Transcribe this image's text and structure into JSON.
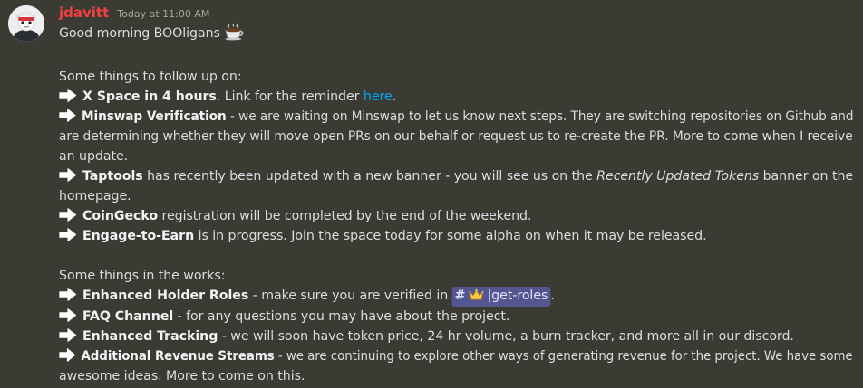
{
  "message": {
    "author": "jdavitt",
    "timestamp": "Today at 11:00 AM",
    "greeting": "Good morning BOOligans",
    "greeting_emoji": "coffee-emoji",
    "follow_up_heading": "Some things to follow up on:",
    "xspace": {
      "bold": "X Space in 4 hours",
      "text": ". Link for the reminder ",
      "link": "here",
      "end": "."
    },
    "minswap": {
      "bold": "Minswap Verification",
      "line1": " - we are waiting on Minswap to let us know next steps. They are switching repositories on Github and",
      "line2": "are determining whether they will move open PRs on our behalf or request us to re-create the PR. More to come when I receive",
      "line3": "an update."
    },
    "taptools": {
      "bold": "Taptools",
      "line1": " has recently been updated with a new banner - you will see us on the ",
      "italic": "Recently Updated Tokens",
      "line1_end": " banner on the",
      "line2": "homepage."
    },
    "coingecko": {
      "bold": "CoinGecko",
      "text": " registration will be completed by the end of the weekend."
    },
    "engage": {
      "bold": "Engage-to-Earn",
      "text": " is in progress. Join the space today for some alpha on when it may be released."
    },
    "works_heading": "Some things in the works:",
    "holder_roles": {
      "bold": "Enhanced Holder Roles",
      "text": " - make sure you are verified in ",
      "channel_mention": "get-roles",
      "end": "."
    },
    "faq": {
      "bold": "FAQ Channel",
      "text": " - for any questions you may have about the project."
    },
    "tracking": {
      "bold": "Enhanced Tracking",
      "text": " - we will soon have token price, 24 hr volume, a burn tracker, and more all in our discord."
    },
    "revenue": {
      "bold": "Additional Revenue Streams",
      "line1": " - we are continuing to explore other ways of generating revenue for the project. We have some",
      "line2": "awesome ideas. More to come on this."
    }
  },
  "colors": {
    "background": "#3b3a33",
    "username": "#f23f43",
    "link": "#00a8fc",
    "mention_bg": "#54568f"
  }
}
